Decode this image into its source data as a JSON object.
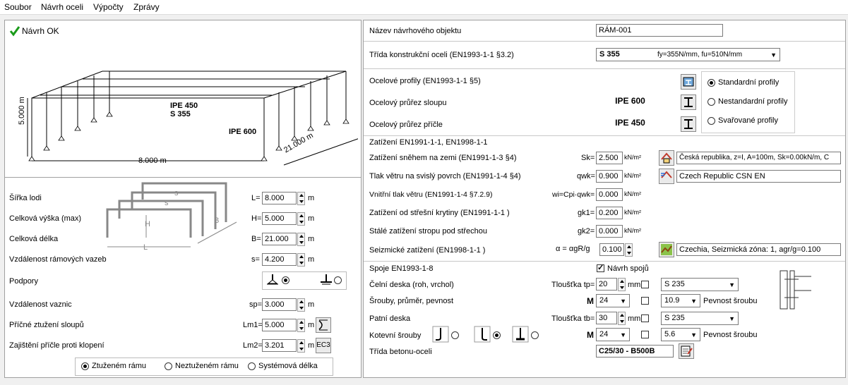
{
  "menu": [
    "Soubor",
    "Návrh oceli",
    "Výpočty",
    "Zprávy"
  ],
  "status": {
    "text": "Návrh OK"
  },
  "drawing": {
    "beam_label": "IPE 450",
    "steel_label": "S 355",
    "column_label": "IPE 600",
    "width_label": "8.000 m",
    "height_label": "5.000 m",
    "length_label": "21.000 m"
  },
  "schema": {
    "s": "s",
    "h": "H",
    "l": "L",
    "b": "B"
  },
  "geometry": [
    {
      "label": "Šířka lodi",
      "sym": "L=",
      "value": "8.000",
      "unit": "m"
    },
    {
      "label": "Celková výška (max)",
      "sym": "H=",
      "value": "5.000",
      "unit": "m"
    },
    {
      "label": "Celková délka",
      "sym": "B=",
      "value": "21.000",
      "unit": "m"
    },
    {
      "label": "Vzdálenost rámových vazeb",
      "sym": "s=",
      "value": "4.200",
      "unit": "m"
    }
  ],
  "supports": {
    "label": "Podpory"
  },
  "purlins": {
    "label": "Vzdálenost vaznic",
    "sym": "sp=",
    "value": "3.000",
    "unit": "m"
  },
  "bracing": {
    "label": "Příčné ztužení sloupů",
    "sym": "Lm1=",
    "value": "5.000",
    "unit": "m"
  },
  "restraint": {
    "label": "Zajištění příčle proti klopení",
    "sym": "Lm2=",
    "value": "3.201",
    "unit": "m",
    "btn": "EC3"
  },
  "frame_options": [
    "Ztuženém rámu",
    "Neztuženém rámu",
    "Systémová délka"
  ],
  "object_name": {
    "label": "Název návrhového objektu",
    "value": "RÁM-001"
  },
  "steel_class": {
    "label": "Třída konstrukční oceli (EN1993-1-1 §3.2)",
    "grade": "S 355",
    "props": "fy=355N/mm, fu=510N/mm"
  },
  "profiles": {
    "label": "Ocelové profily (EN1993-1-1 §5)",
    "column_label": "Ocelový průřez sloupu",
    "column_value": "IPE 600",
    "beam_label": "Ocelový průřez příčle",
    "beam_value": "IPE 450",
    "types": [
      "Standardní profily",
      "Nestandardní profily",
      "Svařované profily"
    ]
  },
  "loads": {
    "header": "Zatížení   EN1991-1-1, EN1998-1-1",
    "kn": "kN/m²",
    "rows": [
      {
        "label": "Zatížení sněhem na zemi (EN1991-1-3 §4)",
        "sym": "Sk=",
        "value": "2.500",
        "info": "Česká republika, z=I, A=100m, Sk=0.00kN/m, C"
      },
      {
        "label": "Tlak větru na svislý povrch (EN1991-1-4 §4)",
        "sym": "qwk=",
        "value": "0.900",
        "info": "Czech Republic CSN EN"
      },
      {
        "label": "Vnitřní tlak větru (EN1991-1-4 §7.2.9)",
        "sym": "wi=Cpi·qwk=",
        "value": "0.000"
      },
      {
        "label": "Zatížení od střešní krytiny (EN1991-1-1  )",
        "sym": "gk1=",
        "value": "0.200"
      },
      {
        "label": "Stálé zatížení stropu pod střechou",
        "sym": "gk2=",
        "value": "0.000"
      }
    ],
    "seismic": {
      "label": "Seizmické zatížení (EN1998-1-1 )",
      "sym": "α = αgR/g",
      "value": "0.100",
      "info": "Czechia, Seizmická zóna:  1, agr/g=0.100"
    }
  },
  "connections": {
    "header": "Spoje  EN1993-1-8",
    "design_label": "Návrh spojů",
    "end_plate": {
      "label": "Čelní deska (roh, vrchol)",
      "thick_label": "Tloušťka tp=",
      "thick": "20",
      "unit": "mm",
      "steel": "S 235"
    },
    "bolts": {
      "label": "Šrouby, průměr, pevnost",
      "m": "M",
      "size": "24",
      "grade": "10.9",
      "grade_label": "Pevnost šroubu"
    },
    "base_plate": {
      "label": "Patní deska",
      "thick_label": "Tloušťka tb=",
      "thick": "30",
      "unit": "mm",
      "steel": "S 235"
    },
    "anchor": {
      "label": "Kotevní šrouby",
      "m": "M",
      "size": "24",
      "grade": "5.6",
      "grade_label": "Pevnost šroubu"
    },
    "concrete": {
      "label": "Třída betonu-oceli",
      "value": "C25/30 - B500B"
    }
  }
}
